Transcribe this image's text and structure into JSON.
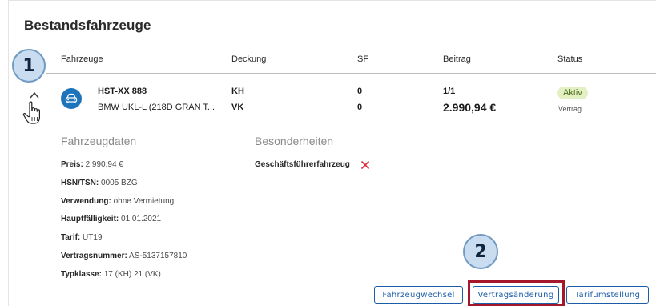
{
  "page": {
    "title": "Bestandsfahrzeuge"
  },
  "table": {
    "headers": {
      "fahrzeuge": "Fahrzeuge",
      "deckung": "Deckung",
      "sf": "SF",
      "beitrag": "Beitrag",
      "status": "Status"
    },
    "row": {
      "plate": "HST-XX 888",
      "model": "BMW UKL-L (218D GRAN T...",
      "deckung": [
        "KH",
        "VK"
      ],
      "sf": [
        "0",
        "0"
      ],
      "beitrag_ratio": "1/1",
      "beitrag_amount": "2.990,94 €",
      "status_badge": "Aktiv",
      "status_sub": "Vertrag"
    }
  },
  "details": {
    "fahrzeugdaten_title": "Fahrzeugdaten",
    "besonderheiten_title": "Besonderheiten",
    "fields": [
      {
        "key": "Preis:",
        "value": "2.990,94 €"
      },
      {
        "key": "HSN/TSN:",
        "value": "0005 BZG"
      },
      {
        "key": "Verwendung:",
        "value": "ohne Vermietung"
      },
      {
        "key": "Hauptfälligkeit:",
        "value": "01.01.2021"
      },
      {
        "key": "Tarif:",
        "value": "UT19"
      },
      {
        "key": "Vertragsnummer:",
        "value": "AS-5137157810"
      },
      {
        "key": "Typklasse:",
        "value": "17 (KH) 21 (VK)"
      }
    ],
    "besonderheit": "Geschäftsführerfahrzeug"
  },
  "actions": {
    "fahrzeugwechsel": "Fahrzeugwechsel",
    "vertragsaenderung": "Vertragsänderung",
    "tarifumstellung": "Tarifumstellung"
  },
  "callouts": [
    "1",
    "2"
  ],
  "colors": {
    "primary": "#1c5da8",
    "car_icon_bg": "#1c74bc",
    "status_bg": "#e3f0c4",
    "status_text": "#4d6e19",
    "highlight": "#a5182b",
    "callout_fill": "#c9dcf0",
    "callout_border": "#6f9ac2",
    "remove_red": "#e0283a"
  },
  "icons": {
    "expand": "chevron-up-icon",
    "cursor": "hand-pointer-icon",
    "vehicle": "car-icon",
    "remove": "close-icon"
  }
}
